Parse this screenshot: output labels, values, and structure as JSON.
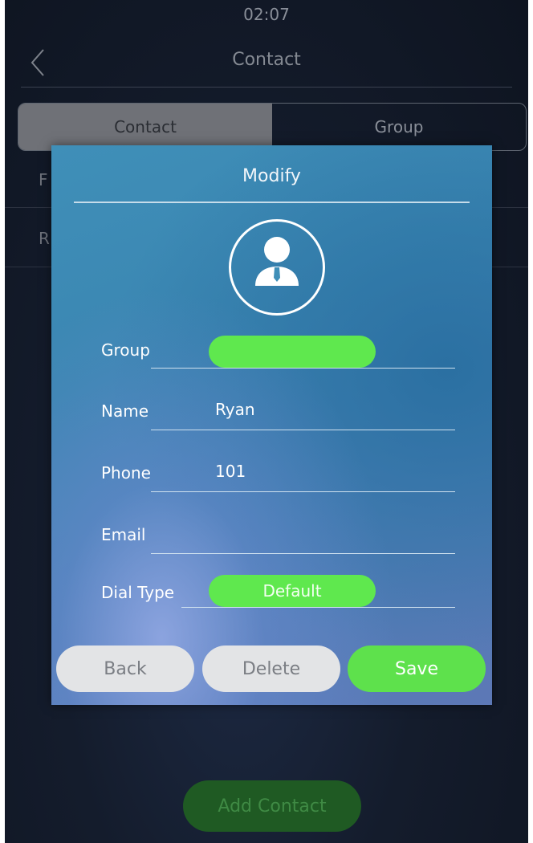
{
  "status": {
    "time": "02:07"
  },
  "header": {
    "title": "Contact"
  },
  "tabs": [
    {
      "label": "Contact",
      "active": true
    },
    {
      "label": "Group",
      "active": false
    }
  ],
  "background_rows": [
    "F",
    "R"
  ],
  "footer": {
    "add_contact_label": "Add Contact"
  },
  "dialog": {
    "title": "Modify",
    "avatar_icon": "user-avatar-icon",
    "fields": {
      "group": {
        "label": "Group",
        "value": ""
      },
      "name": {
        "label": "Name",
        "value": "Ryan"
      },
      "phone": {
        "label": "Phone",
        "value": "101"
      },
      "email": {
        "label": "Email",
        "value": ""
      },
      "dial_type": {
        "label": "Dial Type",
        "value": "Default"
      }
    },
    "buttons": {
      "back": "Back",
      "delete": "Delete",
      "save": "Save"
    }
  },
  "colors": {
    "accent_green": "#5fe84e",
    "dialog_blue": "#3f8fb8",
    "button_grey": "#e3e4e6"
  }
}
